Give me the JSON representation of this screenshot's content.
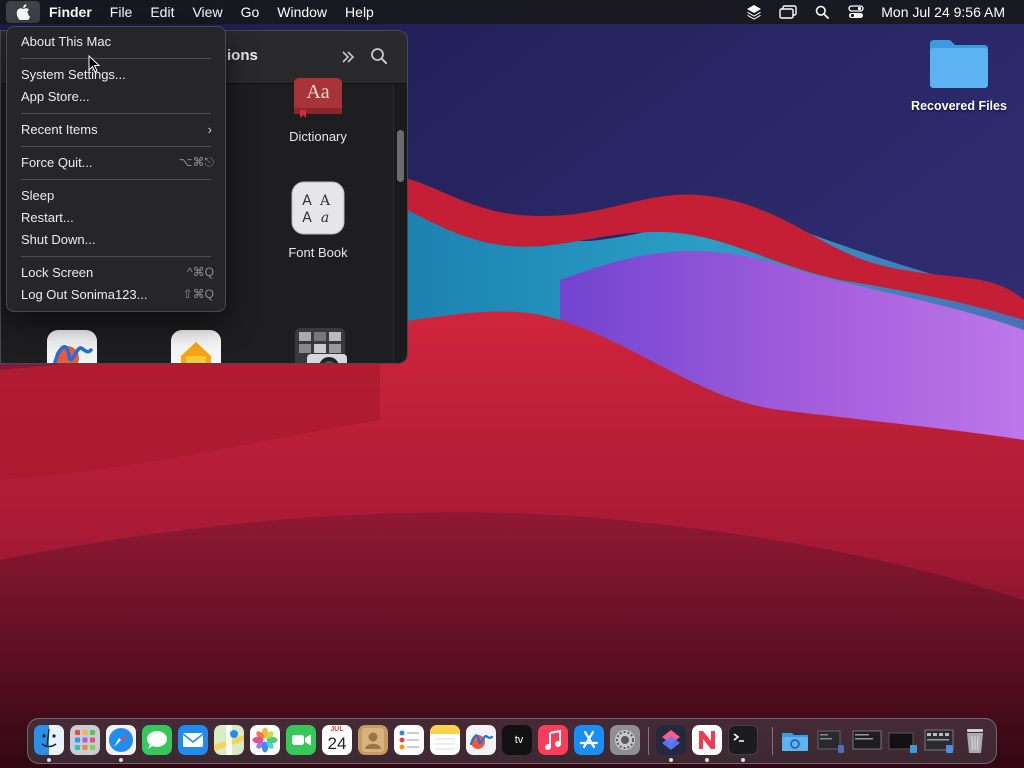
{
  "menubar": {
    "app_name": "Finder",
    "menus": [
      "File",
      "Edit",
      "View",
      "Go",
      "Window",
      "Help"
    ],
    "clock": "Mon Jul 24  9:56 AM",
    "status_icons": [
      "layers-icon",
      "screens-icon",
      "search-icon",
      "control-center-icon"
    ]
  },
  "apple_menu": {
    "items": [
      {
        "label": "About This Mac",
        "shortcut": ""
      },
      {
        "label": "System Settings...",
        "shortcut": ""
      },
      {
        "label": "App Store...",
        "shortcut": ""
      },
      {
        "label": "Recent Items",
        "shortcut": ""
      },
      {
        "label": "Force Quit...",
        "shortcut": "⌥⌘⎋"
      },
      {
        "label": "Sleep",
        "shortcut": ""
      },
      {
        "label": "Restart...",
        "shortcut": ""
      },
      {
        "label": "Shut Down...",
        "shortcut": ""
      },
      {
        "label": "Lock Screen",
        "shortcut": "^⌘Q"
      },
      {
        "label": "Log Out Sonima123...",
        "shortcut": "⇧⌘Q"
      }
    ]
  },
  "finder": {
    "title_fragment": "ions",
    "apps": [
      {
        "label": "Dictionary",
        "icon": "dictionary-icon"
      },
      {
        "label": "Font Book",
        "icon": "font-book-icon"
      },
      {
        "label": "",
        "icon": "freeform-icon"
      },
      {
        "label": "",
        "icon": "home-icon"
      },
      {
        "label": "",
        "icon": "image-capture-icon"
      }
    ]
  },
  "desktop": {
    "folder_label": "Recovered Files"
  },
  "dock": {
    "calendar_day": "24",
    "calendar_month": "JUL",
    "tv_label": "tv",
    "apps": [
      "finder-icon",
      "launchpad-icon",
      "safari-icon",
      "messages-icon",
      "mail-icon",
      "maps-icon",
      "photos-icon",
      "facetime-icon",
      "calendar-icon",
      "contacts-icon",
      "reminders-icon",
      "notes-icon",
      "freeform-icon",
      "apple-tv-icon",
      "music-icon",
      "app-store-icon",
      "system-settings-icon",
      "shortcuts-icon",
      "news-icon",
      "terminal-icon",
      "downloads-folder-icon",
      "window-thumb-1-icon",
      "window-thumb-2-icon",
      "window-thumb-3-icon",
      "window-thumb-4-icon",
      "trash-icon"
    ]
  },
  "colors": {
    "menubar_bg": "#18181c",
    "menu_bg": "#262628",
    "accent_blue": "#1a7cf2"
  }
}
